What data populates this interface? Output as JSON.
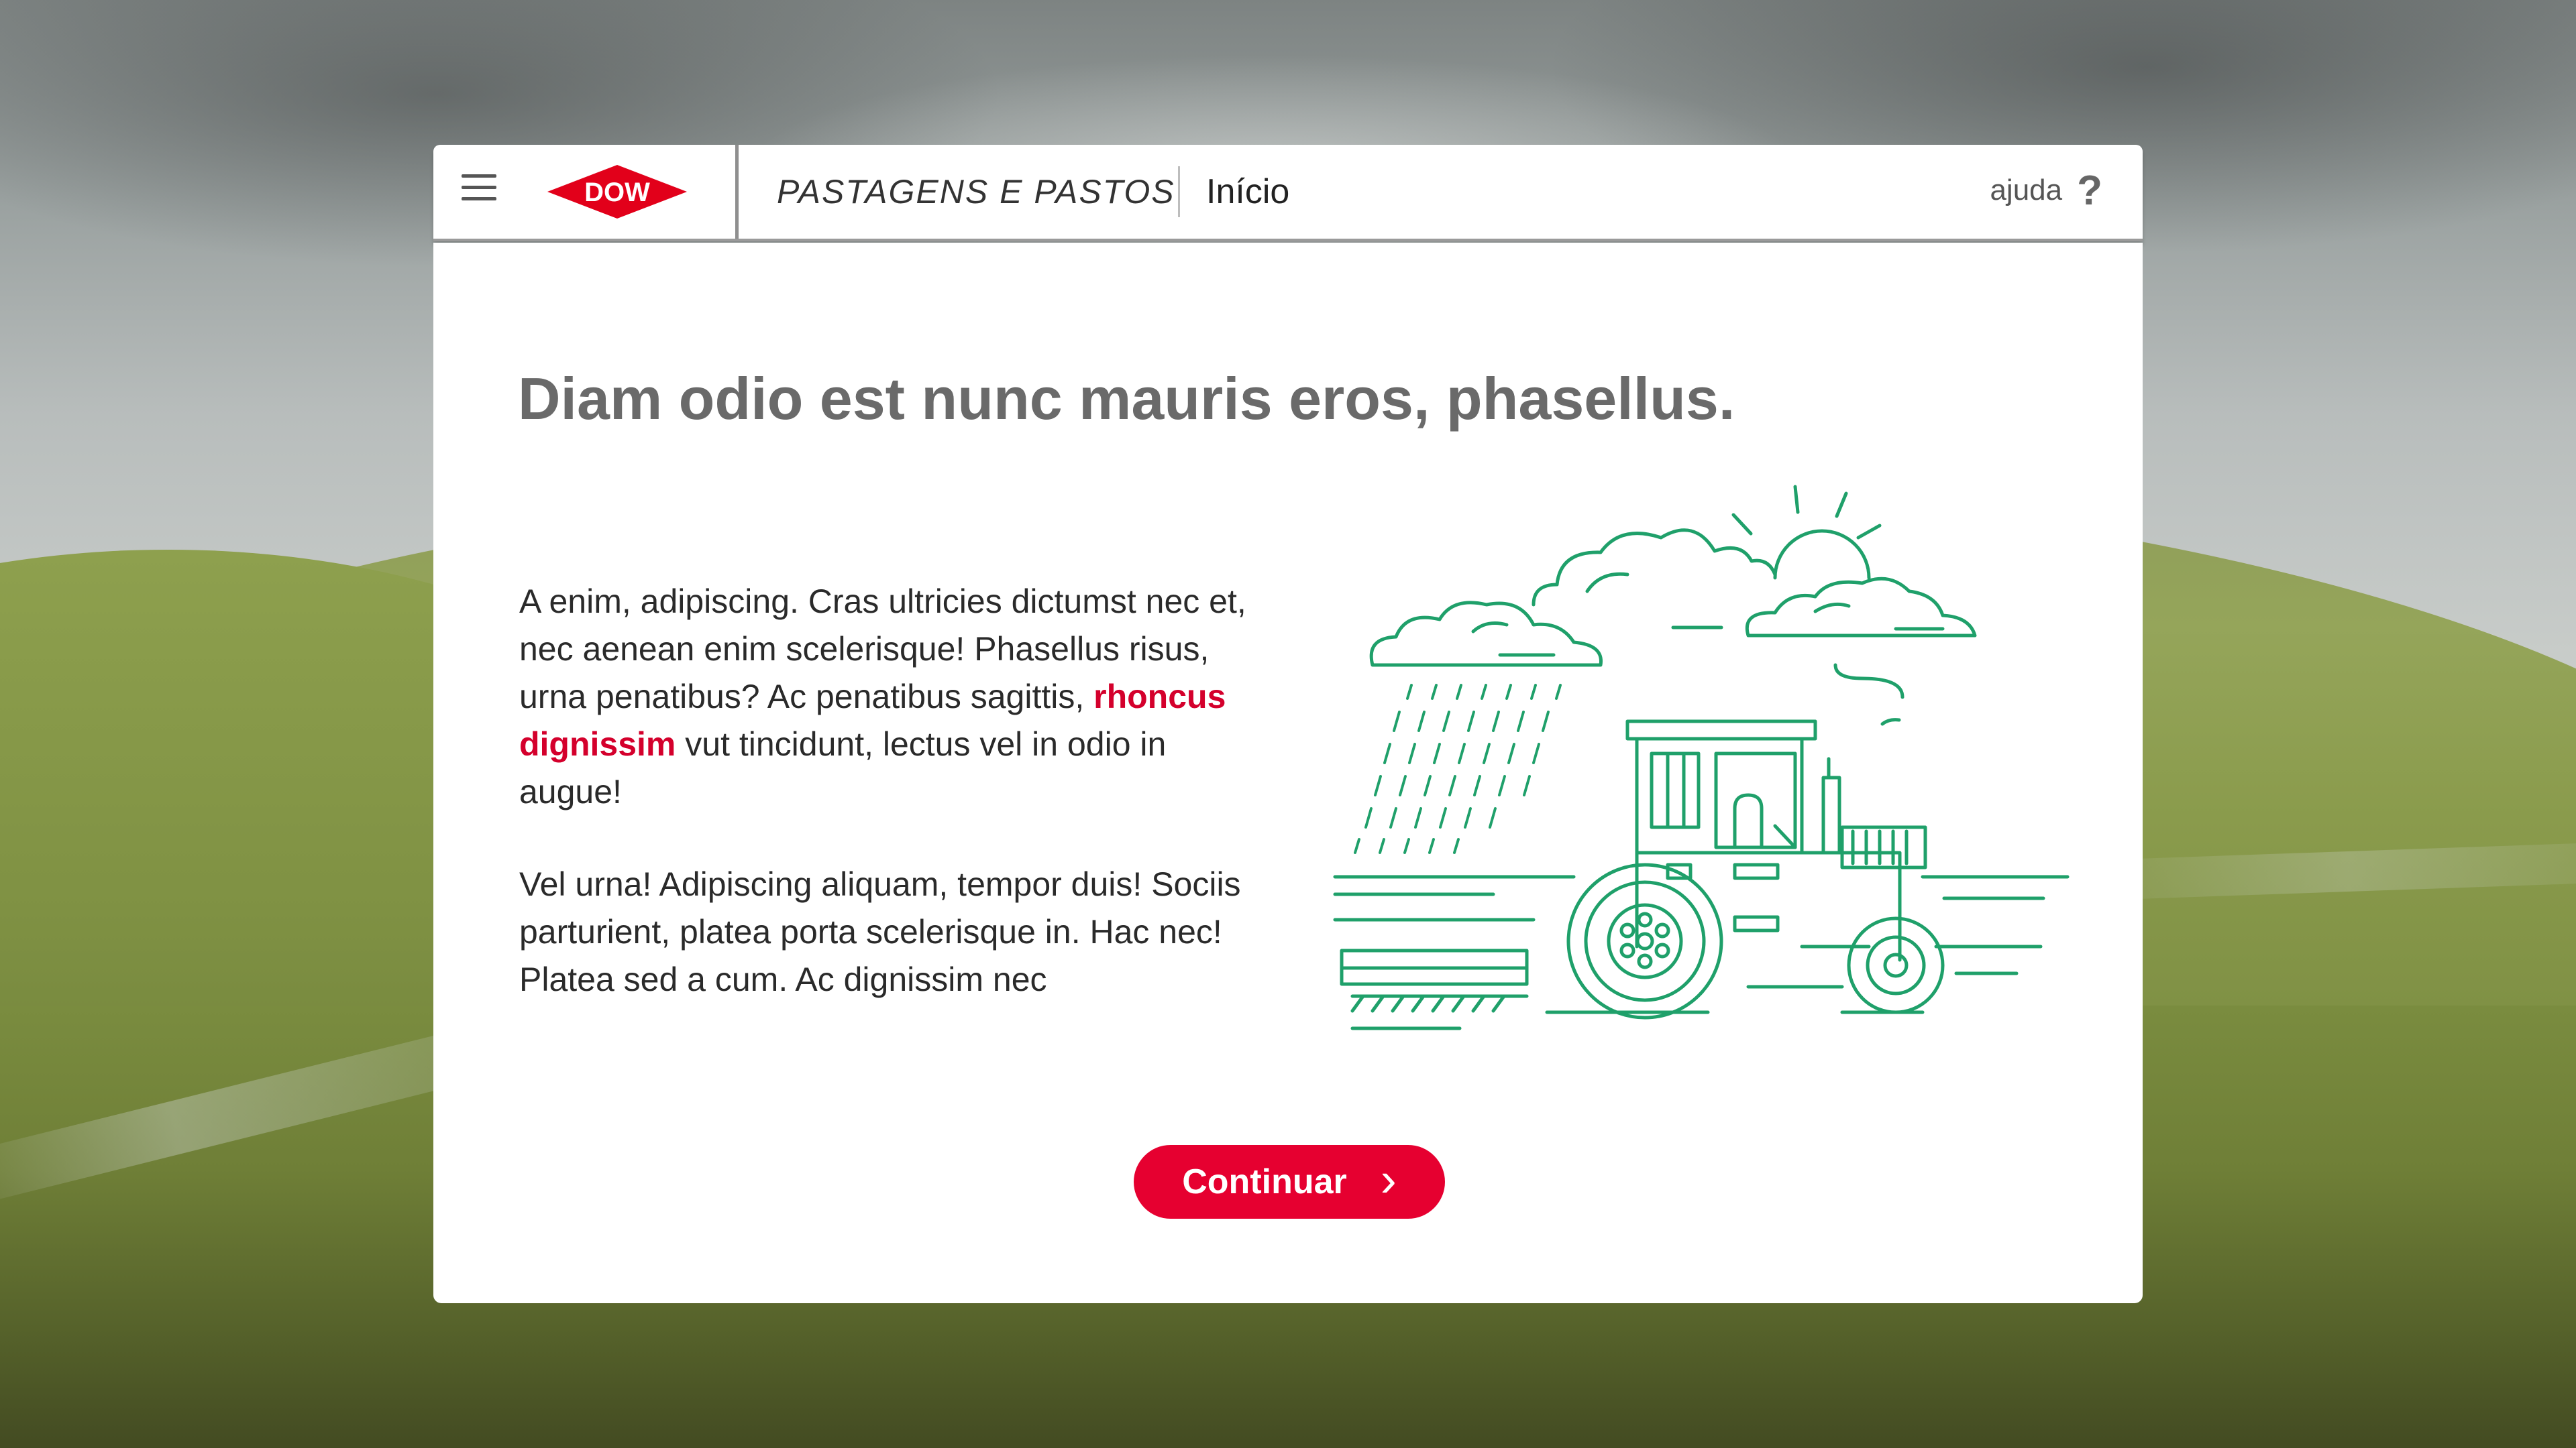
{
  "header": {
    "menu_icon": "hamburger-menu-icon",
    "logo_text": "DOW",
    "section_title": "PASTAGENS E PASTOS",
    "breadcrumb": "Início",
    "help_label": "ajuda",
    "help_icon": "?"
  },
  "main": {
    "headline": "Diam odio est nunc mauris eros, phasellus.",
    "paragraph1_before": "A enim, adipiscing. Cras ultricies dictumst nec et, nec aenean enim scelerisque! Phasellus risus, urna penatibus? Ac penatibus sagittis, ",
    "paragraph1_highlight": "rhoncus dignissim",
    "paragraph1_after": " vut tincidunt, lectus vel in odio in augue!",
    "paragraph2": "Vel urna! Adipiscing aliquam, tempor duis! Sociis parturient, platea porta scelerisque in. Hac nec! Platea sed a cum. Ac dignissim nec",
    "illustration_icon": "tractor-rain-illustration",
    "continue_label": "Continuar",
    "continue_icon": "›"
  },
  "colors": {
    "accent_red": "#e60030",
    "highlight_red": "#d4002c",
    "illustration_green": "#1fa06a",
    "headline_gray": "#6a6a6a"
  }
}
